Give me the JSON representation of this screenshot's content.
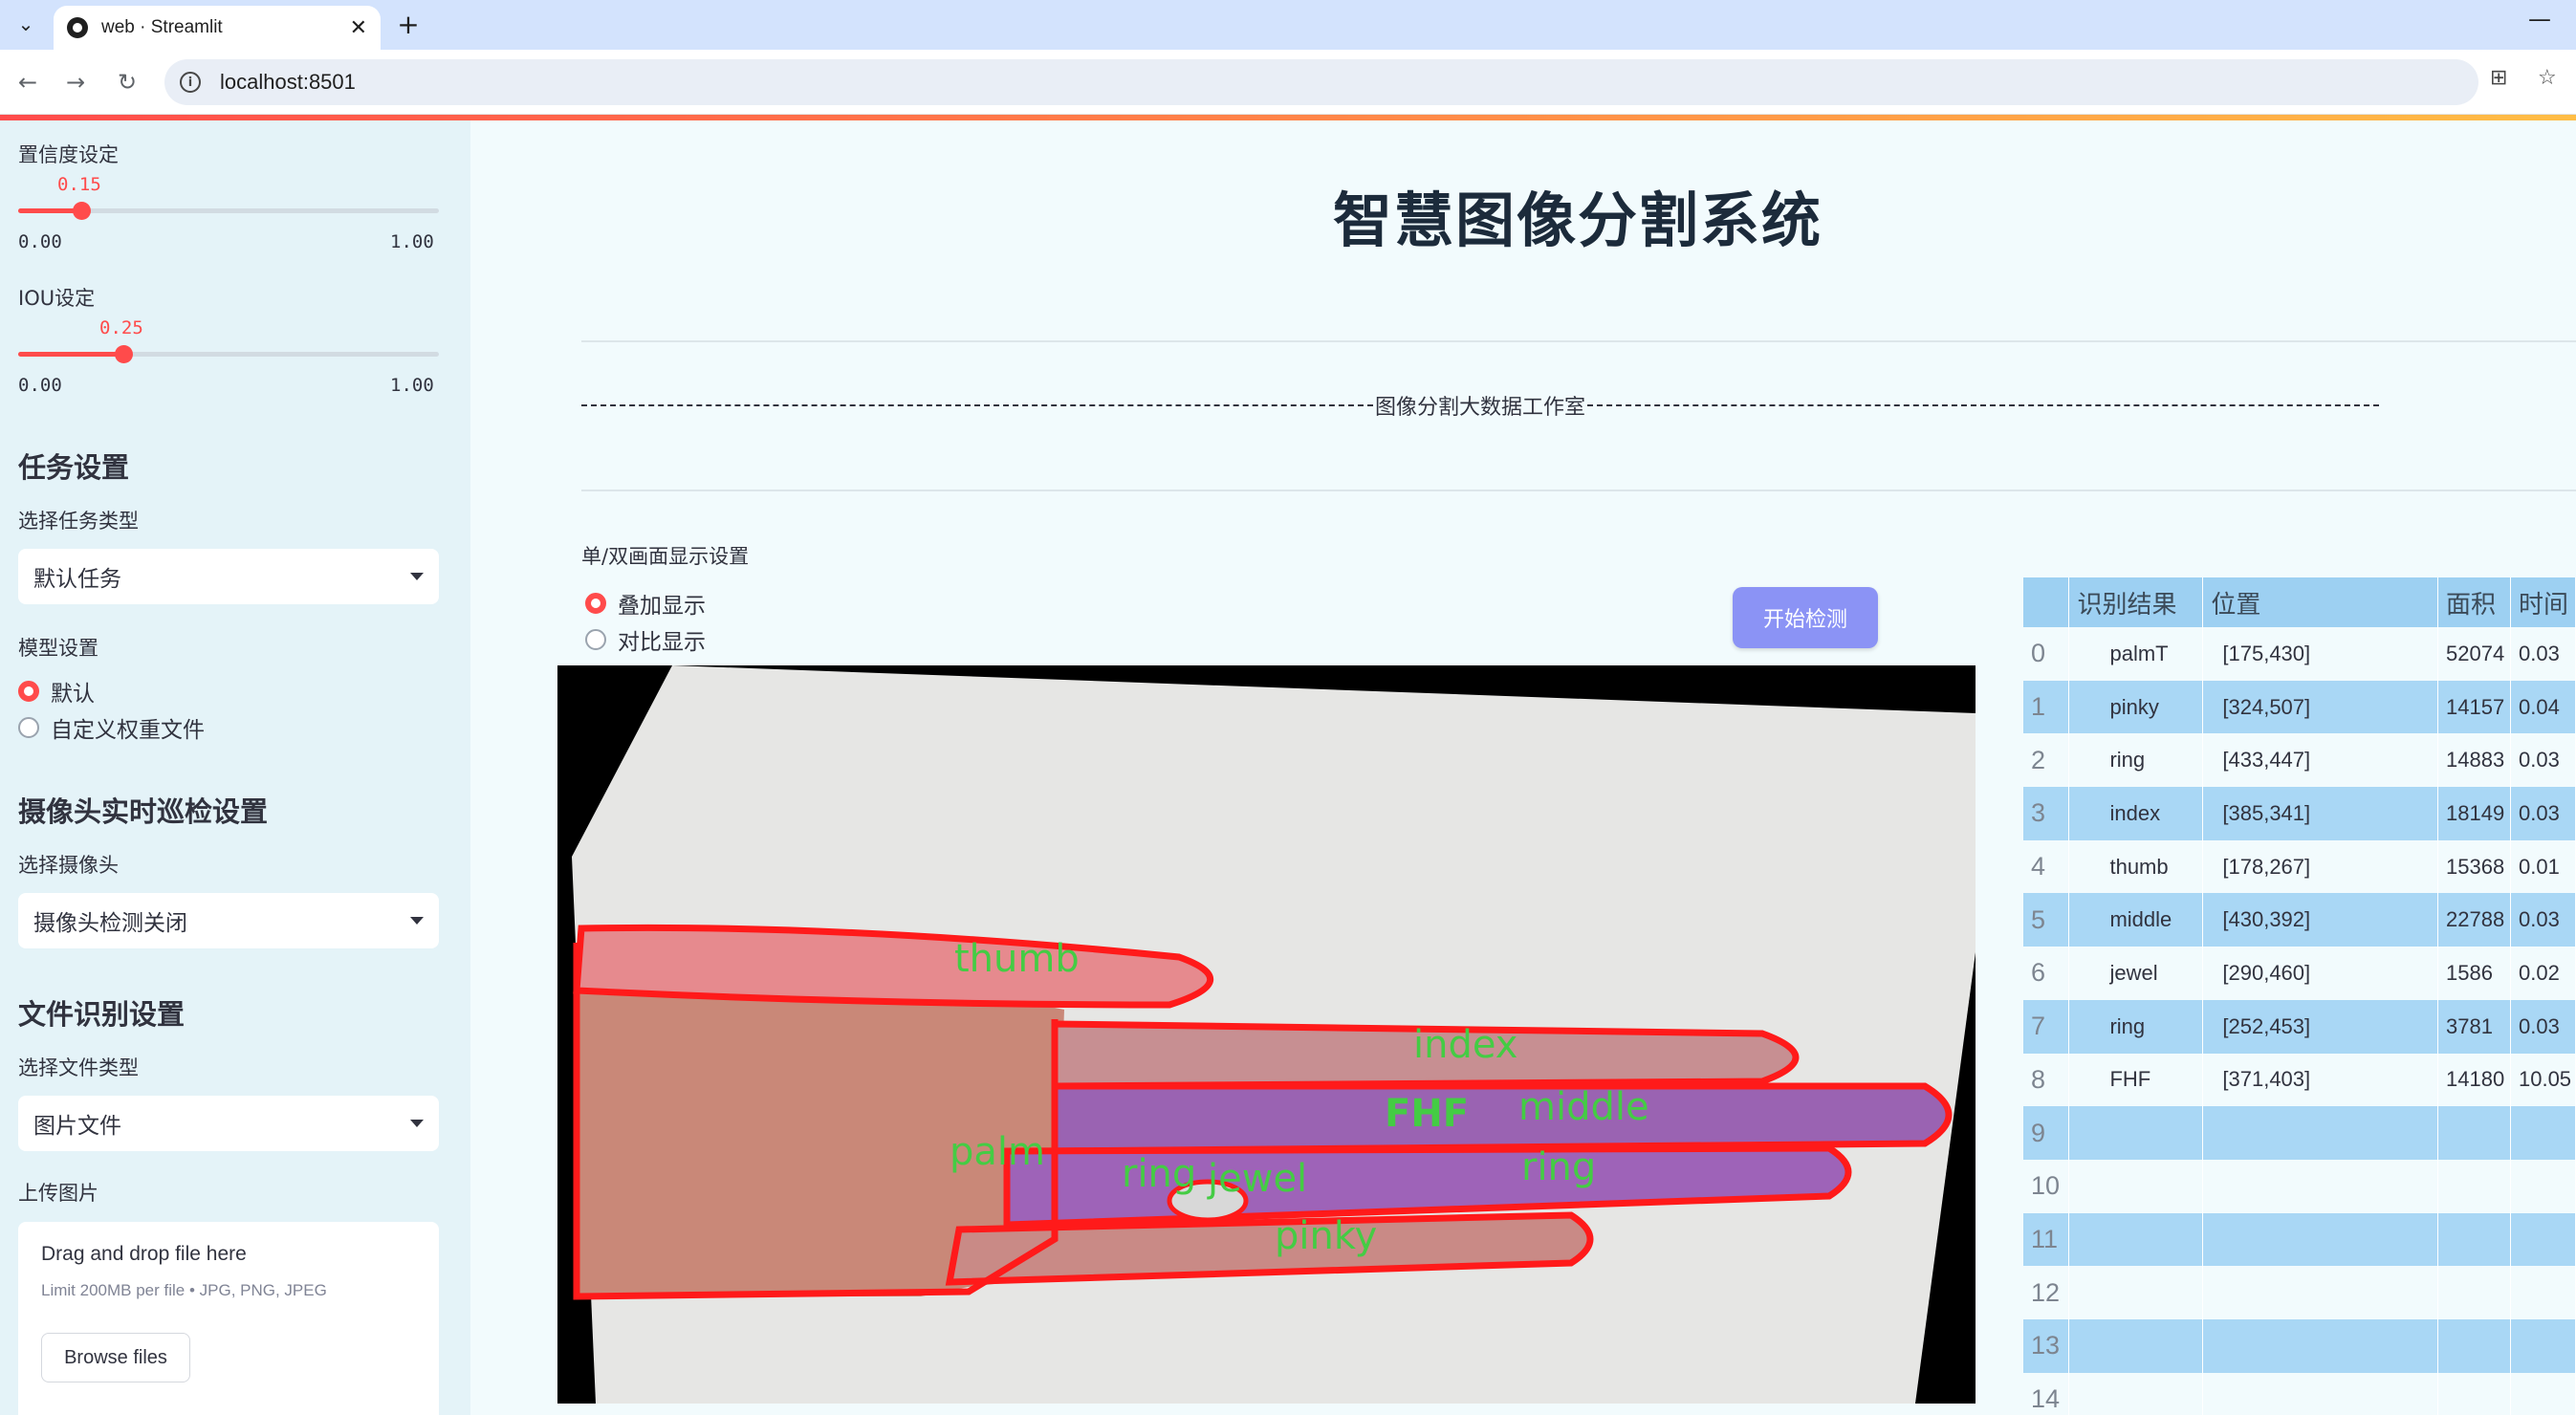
{
  "browser": {
    "tab_title": "web · Streamlit",
    "url": "localhost:8501"
  },
  "sidebar": {
    "confidence": {
      "label": "置信度设定",
      "value": "0.15",
      "min": "0.00",
      "max": "1.00",
      "fraction": 0.15
    },
    "iou": {
      "label": "IOU设定",
      "value": "0.25",
      "min": "0.00",
      "max": "1.00",
      "fraction": 0.25
    },
    "task_header": "任务设置",
    "task_type_label": "选择任务类型",
    "task_type_value": "默认任务",
    "model_label": "模型设置",
    "model_options": [
      "默认",
      "自定义权重文件"
    ],
    "camera_header": "摄像头实时巡检设置",
    "camera_label": "选择摄像头",
    "camera_value": "摄像头检测关闭",
    "file_header": "文件识别设置",
    "file_type_label": "选择文件类型",
    "file_type_value": "图片文件",
    "upload_label": "上传图片",
    "upload_title": "Drag and drop file here",
    "upload_limit": "Limit 200MB per file • JPG, PNG, JPEG",
    "browse_button": "Browse files"
  },
  "main": {
    "title": "智慧图像分割系统",
    "studio": "图像分割大数据工作室",
    "display_label": "单/双画面显示设置",
    "display_options": [
      "叠加显示",
      "对比显示"
    ],
    "start_button": "开始检测"
  },
  "image_labels": {
    "thumb": "thumb",
    "index": "index",
    "fhf": "FHF",
    "middle": "middle",
    "palm": "palm",
    "ring1": "ring",
    "ring2": "ring",
    "jewel": "jewel",
    "pinky": "pinky"
  },
  "table": {
    "columns": [
      "",
      "识别结果",
      "位置",
      "面积",
      "时间"
    ],
    "rows": [
      [
        "0",
        "palmT",
        "[175,430]",
        "52074",
        "0.03"
      ],
      [
        "1",
        "pinky",
        "[324,507]",
        "14157",
        "0.04"
      ],
      [
        "2",
        "ring",
        "[433,447]",
        "14883",
        "0.03"
      ],
      [
        "3",
        "index",
        "[385,341]",
        "18149",
        "0.03"
      ],
      [
        "4",
        "thumb",
        "[178,267]",
        "15368",
        "0.01"
      ],
      [
        "5",
        "middle",
        "[430,392]",
        "22788",
        "0.03"
      ],
      [
        "6",
        "jewel",
        "[290,460]",
        "1586",
        "0.02"
      ],
      [
        "7",
        "ring",
        "[252,453]",
        "3781",
        "0.03"
      ],
      [
        "8",
        "FHF",
        "[371,403]",
        "14180",
        "10.05"
      ],
      [
        "9",
        "",
        "",
        "",
        ""
      ],
      [
        "10",
        "",
        "",
        "",
        ""
      ],
      [
        "11",
        "",
        "",
        "",
        ""
      ],
      [
        "12",
        "",
        "",
        "",
        ""
      ],
      [
        "13",
        "",
        "",
        "",
        ""
      ],
      [
        "14",
        "",
        "",
        "",
        ""
      ]
    ]
  }
}
